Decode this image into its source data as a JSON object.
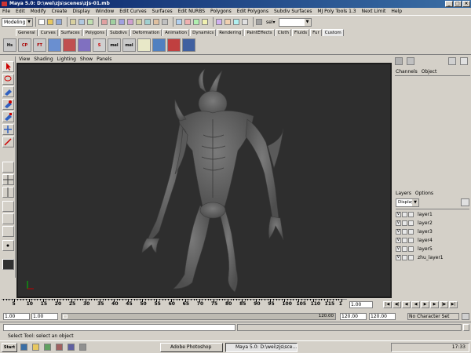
{
  "window": {
    "title": "Maya 5.0: D:\\wei\\zjs\\scenes\\zjs-01.mb"
  },
  "menubar": {
    "items": [
      "File",
      "Edit",
      "Modify",
      "Create",
      "Display",
      "Window",
      "Edit Curves",
      "Surfaces",
      "Edit NURBS",
      "Polygons",
      "Edit Polygons",
      "Subdiv Surfaces",
      "MJ Poly Tools 1.3",
      "Next Limit",
      "Help"
    ]
  },
  "statusline": {
    "mode": "Modeling",
    "sel_label": "sel▾"
  },
  "shelf": {
    "tabs": [
      "General",
      "Curves",
      "Surfaces",
      "Polygons",
      "Subdivs",
      "Deformation",
      "Animation",
      "Dynamics",
      "Rendering",
      "PaintEffects",
      "Cloth",
      "Fluids",
      "Fur",
      "Custom"
    ],
    "active_tab": "Custom",
    "buttons": [
      "Hs",
      "CP",
      "FT",
      "",
      "",
      "",
      "",
      "mel",
      "mel",
      "",
      "",
      "",
      ""
    ]
  },
  "panel": {
    "menu": [
      "View",
      "Shading",
      "Lighting",
      "Show",
      "Panels"
    ]
  },
  "channelbox": {
    "menu": [
      "Channels",
      "Object"
    ]
  },
  "layers": {
    "menu": [
      "Layers",
      "Options"
    ],
    "display_mode": "Display",
    "list": [
      {
        "visible": "V",
        "name": "layer1"
      },
      {
        "visible": "V",
        "name": "layer2"
      },
      {
        "visible": "V",
        "name": "layer3"
      },
      {
        "visible": "V",
        "name": "layer4"
      },
      {
        "visible": "V",
        "name": "layer5"
      },
      {
        "visible": "V",
        "name": "zhu_layer1"
      }
    ]
  },
  "timeslider": {
    "ticks": [
      "5",
      "10",
      "15",
      "20",
      "25",
      "30",
      "35",
      "40",
      "45",
      "50",
      "55",
      "60",
      "65",
      "70",
      "75",
      "80",
      "85",
      "90",
      "95",
      "100",
      "105",
      "110",
      "115",
      "1"
    ],
    "current_frame": "1.00"
  },
  "rangeslider": {
    "start": "1.00",
    "start2": "1.00",
    "range_end": "120.00",
    "end": "120.00",
    "end2": "120.00",
    "character_set": "No Character Set"
  },
  "helpline": {
    "text": "Select Tool: select an object"
  },
  "taskbar": {
    "start": "Start",
    "tasks": [
      {
        "label": "Adobe Photoshop"
      },
      {
        "label": "Maya 5.0: D:\\wei\\zjs\\sce..."
      }
    ],
    "clock": "17:33"
  },
  "colors": {
    "viewport_bg": "#2e2e2e",
    "model": "#6a6a6a",
    "titlebar": "#0a246a"
  }
}
